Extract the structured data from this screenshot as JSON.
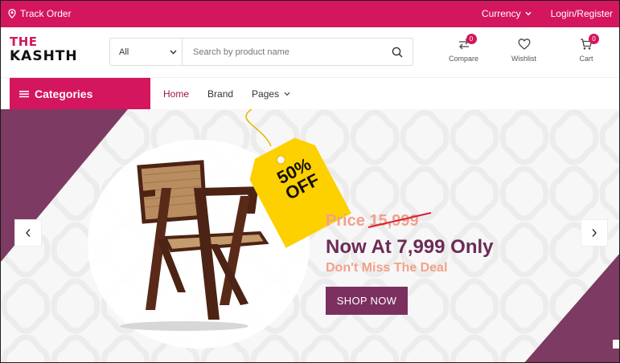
{
  "colors": {
    "brand": "#d3165d",
    "deep": "#7b3060",
    "accent_text": "#f1a18a",
    "now_text": "#6b2b55",
    "tag_yellow": "#fdd000"
  },
  "topbar": {
    "track_label": "Track Order",
    "track_icon": "location-pin-icon",
    "currency_label": "Currency",
    "login_label": "Login/Register"
  },
  "header": {
    "logo_line1": "THE",
    "logo_line2": "KASHTH",
    "search": {
      "category": "All",
      "placeholder": "Search by product name",
      "icon": "search-icon"
    },
    "icons": [
      {
        "name": "compare",
        "label": "Compare",
        "count": "0",
        "icon": "compare-icon"
      },
      {
        "name": "wishlist",
        "label": "Wishlist",
        "icon": "heart-icon"
      },
      {
        "name": "cart",
        "label": "Cart",
        "count": "0",
        "icon": "cart-icon"
      }
    ]
  },
  "nav": {
    "categories_label": "Categories",
    "links": [
      "Home",
      "Brand",
      "Pages"
    ],
    "active": "Home"
  },
  "banner": {
    "discount_line1": "50%",
    "discount_line2": "OFF",
    "price_prefix": "Price ",
    "price_old": "15,999",
    "price_now": "Now At  7,999 Only",
    "deal_text": "Don't Miss The Deal",
    "button_label": "SHOP NOW"
  }
}
